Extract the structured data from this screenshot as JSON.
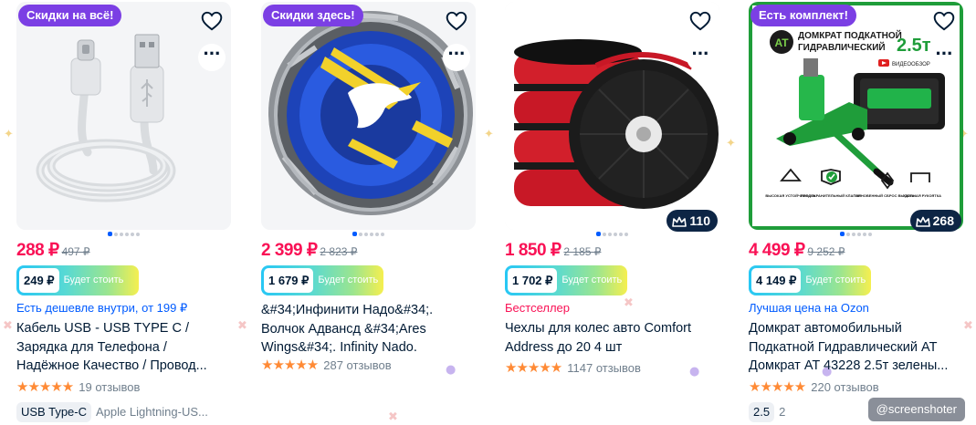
{
  "products": [
    {
      "badge": "Скидки на всё!",
      "price": "288 ₽",
      "old_price": "497 ₽",
      "card_price": "249 ₽",
      "card_label": "Будет стоить",
      "promo": "Есть дешевле внутри, от 199 ₽",
      "title": "Кабель USB - USB TYPE C / Зарядка для Телефона / Надёжное Качество / Провод...",
      "reviews": "19 отзывов",
      "chip": "USB Type-C",
      "chip_extra": "Apple Lightning-US..."
    },
    {
      "badge": "Скидки здесь!",
      "price": "2 399 ₽",
      "old_price": "2 823 ₽",
      "card_price": "1 679 ₽",
      "card_label": "Будет стоить",
      "title": "&#34;Инфинити Надо&#34;. Волчок Адвансд &#34;Ares Wings&#34;. Infinity Nado.",
      "reviews": "287 отзывов"
    },
    {
      "price": "1 850 ₽",
      "old_price": "2 185 ₽",
      "card_price": "1 702 ₽",
      "card_label": "Будет стоить",
      "promo": "Бестселлер",
      "title": "Чехлы для колес авто Comfort Address до 20 4 шт",
      "reviews": "1147 отзывов",
      "crown_count": "110"
    },
    {
      "badge": "Есть комплект!",
      "price": "4 499 ₽",
      "old_price": "9 252 ₽",
      "card_price": "4 149 ₽",
      "card_label": "Будет стоить",
      "promo": "Лучшая цена на Ozon",
      "title": "Домкрат автомобильный Подкатной Гидравлический AT Домкрат AT 43228 2.5т зелены...",
      "reviews": "220 отзывов",
      "crown_count": "268",
      "chip": "2.5",
      "chip_extra": "2",
      "image_text": {
        "brand": "AT",
        "headline_1": "ДОМКРАТ ПОДКАТНОЙ",
        "headline_2": "ГИДРАВЛИЧЕСКИЙ",
        "capacity": "2.5т",
        "video": "ВИДЕООБЗОР",
        "feature_1": "ВЫСОКАЯ УСТОЙЧИВОСТЬ",
        "feature_2": "ПРЕДОХРАНИТЕЛЬНЫЙ КЛАПАН",
        "feature_3": "МГНОВЕННЫЙ СБРОС ВЫСОТЫ",
        "feature_4": "УДОБНАЯ РУКОЯТКА"
      }
    }
  ],
  "colors": {
    "price": "#f91155",
    "badge": "#7b3fe4",
    "link": "#005bff",
    "stars": "#ff8a35",
    "crown_badge": "#0d2545"
  },
  "watermark": "@screenshoter"
}
